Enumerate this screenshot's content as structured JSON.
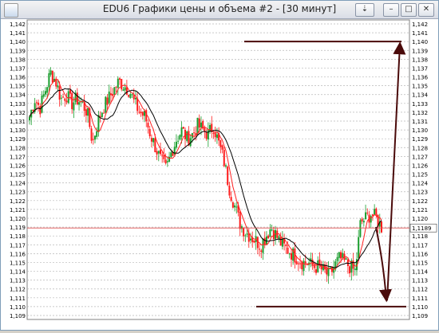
{
  "window": {
    "title": "EDU6 Графики цены и объема #2 - [30 минут]",
    "buttons": {
      "pin": "⇣",
      "minimize": "–",
      "maximize": "□",
      "close": "✕"
    }
  },
  "chart_data": {
    "type": "candlestick",
    "ylim": [
      1.109,
      1.142
    ],
    "yticks": [
      "1,142",
      "1,141",
      "1,140",
      "1,139",
      "1,138",
      "1,137",
      "1,136",
      "1,135",
      "1,134",
      "1,133",
      "1,132",
      "1,131",
      "1,130",
      "1,129",
      "1,128",
      "1,127",
      "1,126",
      "1,125",
      "1,124",
      "1,123",
      "1,122",
      "1,121",
      "1,120",
      "1,119",
      "1,118",
      "1,117",
      "1,116",
      "1,115",
      "1,114",
      "1,113",
      "1,112",
      "1,111",
      "1,110",
      "1,109"
    ],
    "current_price": 1.1189,
    "current_price_label": "1,1189",
    "grid": true,
    "colors": {
      "up": "#1a9e2e",
      "down": "#ff1a1a",
      "ma_fast": "#ff2020",
      "ma_slow": "#000000",
      "annotation": "#4a0a0a",
      "price_line": "#e05050"
    },
    "price_path": [
      1.1315,
      1.1335,
      1.1325,
      1.1345,
      1.1365,
      1.1355,
      1.1335,
      1.134,
      1.133,
      1.1335,
      1.133,
      1.132,
      1.1285,
      1.131,
      1.1325,
      1.1335,
      1.1345,
      1.1355,
      1.135,
      1.1345,
      1.133,
      1.132,
      1.1315,
      1.1295,
      1.128,
      1.1265,
      1.1255,
      1.1275,
      1.129,
      1.13,
      1.129,
      1.1295,
      1.1305,
      1.13,
      1.1295,
      1.1305,
      1.1285,
      1.1265,
      1.1235,
      1.1215,
      1.1195,
      1.1185,
      1.118,
      1.1175,
      1.117,
      1.118,
      1.119,
      1.118,
      1.117,
      1.1165,
      1.116,
      1.1155,
      1.115,
      1.115,
      1.1145,
      1.1145,
      1.114,
      1.1135,
      1.1145,
      1.1155,
      1.115,
      1.1145,
      1.114,
      1.1195,
      1.12,
      1.1205,
      1.12,
      1.119
    ],
    "annotations": [
      {
        "type": "level",
        "label": "target-high",
        "y": 1.14
      },
      {
        "type": "level",
        "label": "target-low",
        "y": 1.11
      },
      {
        "type": "arrow",
        "label": "arrow-down",
        "from": 1.119,
        "to": 1.1105
      },
      {
        "type": "arrow",
        "label": "arrow-up",
        "from": 1.1105,
        "to": 1.14
      }
    ]
  }
}
